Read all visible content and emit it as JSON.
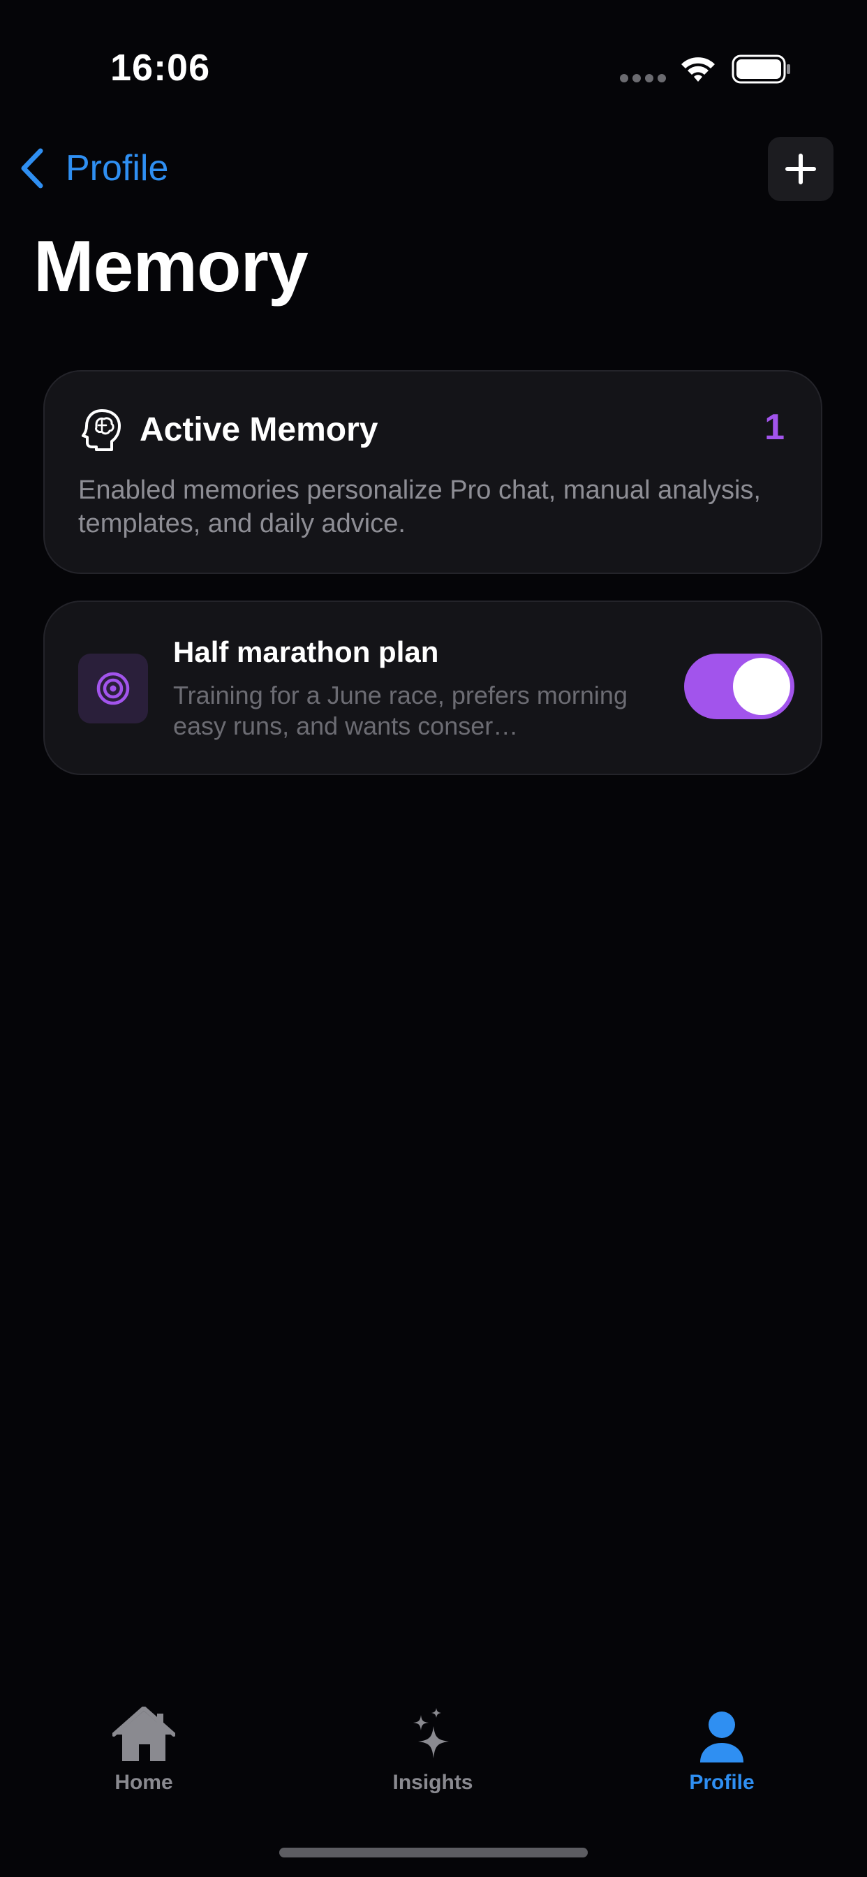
{
  "status_bar": {
    "time": "16:06",
    "icons": [
      "cellular-dots-icon",
      "wifi-icon",
      "battery-icon"
    ]
  },
  "nav": {
    "back_label": "Profile",
    "back_icon": "chevron-left-icon",
    "add_icon": "plus-icon"
  },
  "page": {
    "title": "Memory"
  },
  "summary": {
    "icon": "brain-head-icon",
    "title": "Active Memory",
    "count": "1",
    "description": "Enabled memories personalize Pro chat, manual analysis, templates, and daily advice."
  },
  "memories": [
    {
      "icon": "target-icon",
      "title": "Half marathon plan",
      "description": "Training for a June race, prefers morning easy runs, and wants conser…",
      "enabled": true
    }
  ],
  "tab_bar": {
    "tabs": [
      {
        "label": "Home",
        "icon": "house-icon",
        "active": false
      },
      {
        "label": "Insights",
        "icon": "sparkles-icon",
        "active": false
      },
      {
        "label": "Profile",
        "icon": "person-icon",
        "active": true
      }
    ]
  },
  "colors": {
    "background": "#050508",
    "card": "#141418",
    "accent_blue": "#2f8ff2",
    "accent_purple": "#a254ec",
    "secondary_text": "#8e8e95"
  }
}
